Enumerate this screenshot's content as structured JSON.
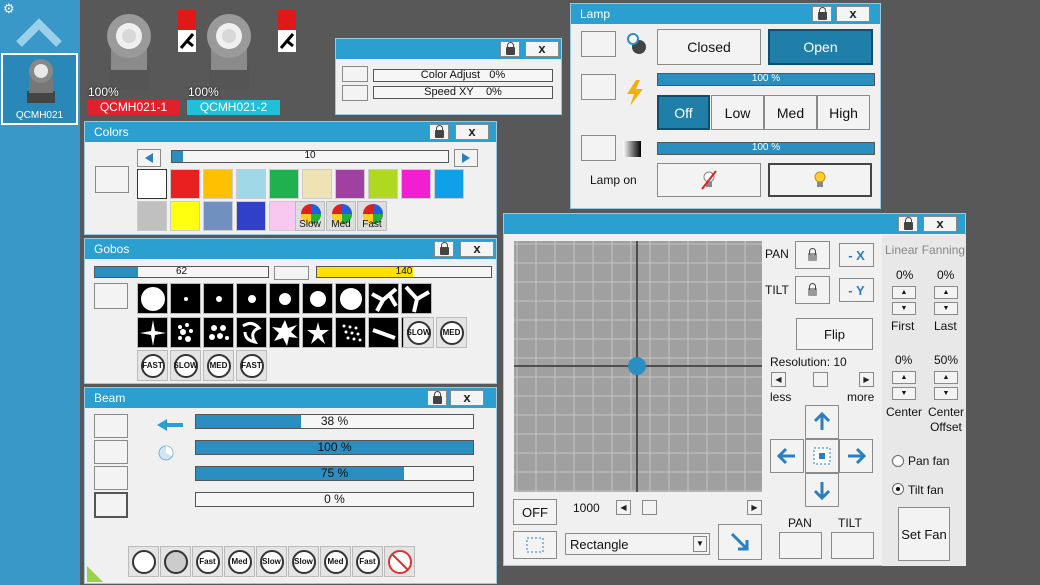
{
  "sidebar": {
    "fixture_label": "QCMH021"
  },
  "fixtures": [
    {
      "intensity": "100%",
      "name": "QCMH021-1",
      "name_color": "#e0202a"
    },
    {
      "intensity": "100%",
      "name": "QCMH021-2",
      "name_color": "#20c0d8"
    }
  ],
  "small_panel": {
    "color_adjust": "Color Adjust",
    "color_adjust_value": "0%",
    "speed_xy": "Speed XY",
    "speed_xy_value": "0%"
  },
  "colors": {
    "title": "Colors",
    "bar_value": "10",
    "swatches_row1": [
      "#ffffff",
      "#e82020",
      "#ffc000",
      "#a0d8e8",
      "#20b050",
      "#efe2b4",
      "#a040a0",
      "#b0d820",
      "#f020d0",
      "#10a0e8"
    ],
    "swatches_row2": [
      "#c0c0c0",
      "#ffff10",
      "#7090c0",
      "#3040c8",
      "#f8c8f0"
    ],
    "wheels": [
      "Slow",
      "Med",
      "Fast"
    ]
  },
  "gobos": {
    "title": "Gobos",
    "bar1_value": "62",
    "bar2_value": "140",
    "wheels": [
      "SLOW",
      "MED",
      "FAST",
      "SLOW",
      "MED",
      "FAST"
    ]
  },
  "beam": {
    "title": "Beam",
    "bars": [
      {
        "label": "38 %",
        "level": 0.38
      },
      {
        "label": "100 %",
        "level": 1.0
      },
      {
        "label": "75 %",
        "level": 0.75
      },
      {
        "label": "0 %",
        "level": 0
      }
    ],
    "wheels": [
      "",
      "",
      "Fast",
      "Med",
      "Slow",
      "Slow",
      "Med",
      "Fast",
      ""
    ]
  },
  "lamp": {
    "title": "Lamp",
    "closed": "Closed",
    "open": "Open",
    "bar1": "100 %",
    "bar2": "100 %",
    "off": "Off",
    "low": "Low",
    "med": "Med",
    "high": "High",
    "lamp_on": "Lamp on"
  },
  "pantilt": {
    "pan": "PAN",
    "tilt": "TILT",
    "neg_x": "- X",
    "neg_y": "- Y",
    "flip": "Flip",
    "resolution": "Resolution: 10",
    "less": "less",
    "more": "more",
    "off": "OFF",
    "speed_value": "1000",
    "shape": "Rectangle",
    "pan_btn": "PAN",
    "tilt_btn": "TILT"
  },
  "fanning": {
    "title": "Linear Fanning",
    "first_val": "0%",
    "last_val": "0%",
    "first": "First",
    "last": "Last",
    "center_val": "0%",
    "offset_val": "50%",
    "center": "Center",
    "center_offset": "Center Offset",
    "pan_fan": "Pan fan",
    "tilt_fan": "Tilt fan",
    "set_fan": "Set Fan"
  },
  "colors_map": {
    "accent": "#2a9fd0",
    "sidebar": "#3a98c8",
    "grid_bg": "#a0a0a0",
    "dot": "#2a8fc0"
  }
}
